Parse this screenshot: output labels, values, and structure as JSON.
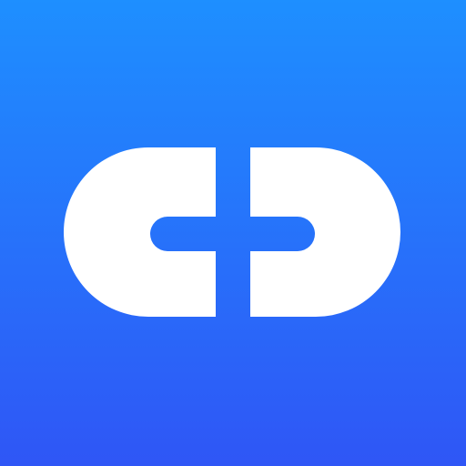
{
  "app_icon": {
    "logo": {
      "icon": "link-icon",
      "color": "#FFFFFF"
    },
    "background": {
      "gradient_top": "#1E8FFF",
      "gradient_bottom": "#2F56F6"
    }
  }
}
